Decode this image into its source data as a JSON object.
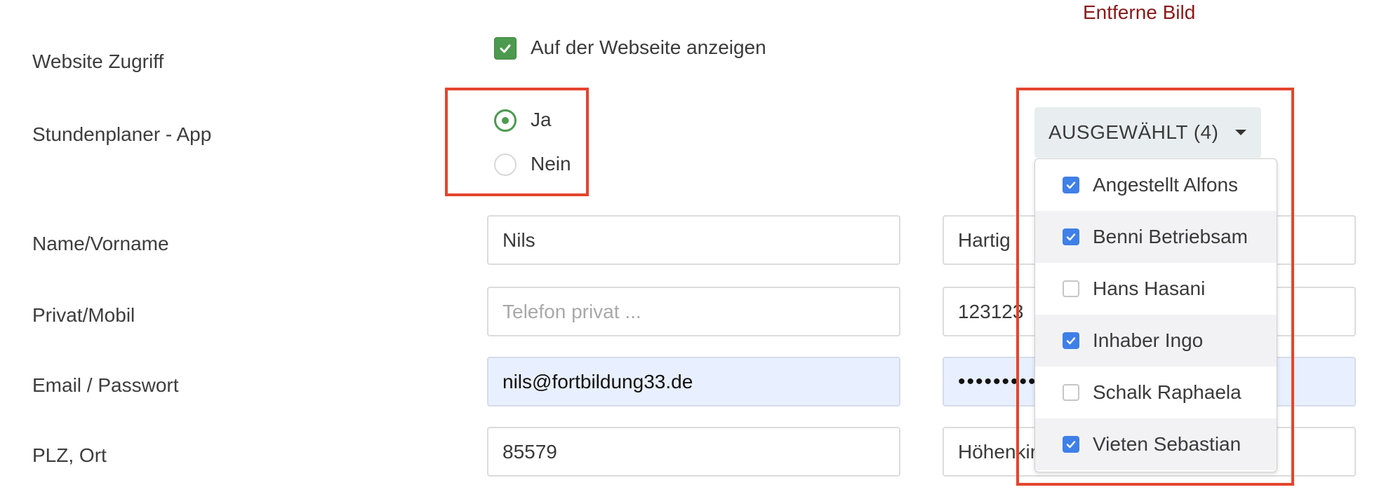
{
  "remove_image": "Entferne Bild",
  "labels": {
    "website": "Website Zugriff",
    "app": "Stundenplaner - App",
    "name": "Name/Vorname",
    "phone": "Privat/Mobil",
    "email": "Email / Passwort",
    "zip": "PLZ, Ort"
  },
  "website_checkbox": {
    "label": "Auf der Webseite anzeigen",
    "checked": true
  },
  "app_radio": {
    "options": [
      {
        "label": "Ja",
        "selected": true
      },
      {
        "label": "Nein",
        "selected": false
      }
    ]
  },
  "fields": {
    "first_name": {
      "value": "Nils",
      "placeholder": ""
    },
    "last_name": {
      "value": "Hartig",
      "placeholder": ""
    },
    "phone_private": {
      "value": "",
      "placeholder": "Telefon privat ..."
    },
    "phone_mobile": {
      "value": "123123",
      "placeholder": ""
    },
    "email": {
      "value": "nils@fortbildung33.de",
      "placeholder": ""
    },
    "password": {
      "value": "••••••••••",
      "placeholder": ""
    },
    "zip": {
      "value": "85579",
      "placeholder": ""
    },
    "city": {
      "value": "Höhenkirchen",
      "placeholder": ""
    }
  },
  "dropdown": {
    "button_label": "AUSGEWÄHLT (4)",
    "items": [
      {
        "label": "Angestellt Alfons",
        "checked": true
      },
      {
        "label": "Benni Betriebsam",
        "checked": true
      },
      {
        "label": "Hans Hasani",
        "checked": false
      },
      {
        "label": "Inhaber Ingo",
        "checked": true
      },
      {
        "label": "Schalk Raphaela",
        "checked": false
      },
      {
        "label": "Vieten Sebastian",
        "checked": true
      }
    ]
  },
  "colors": {
    "accent_green": "#4c9a4e",
    "checkbox_blue": "#3f7fe8",
    "highlight_red": "#e4452e",
    "link_red": "#8b1a1a",
    "autofill_bg": "#e8effe"
  }
}
